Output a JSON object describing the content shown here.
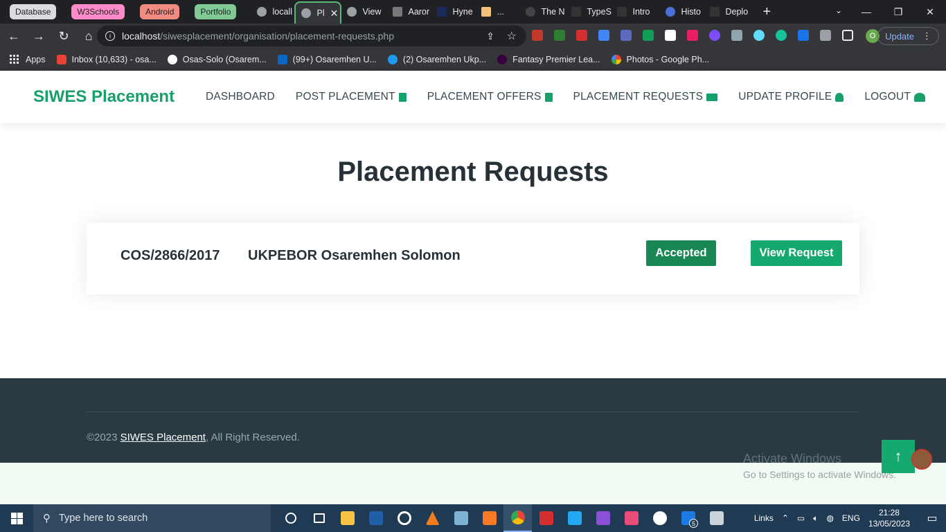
{
  "browser": {
    "tab_groups": [
      {
        "label": "Database",
        "color": "#dadce0"
      },
      {
        "label": "W3Schools",
        "color": "#ff8bcb"
      },
      {
        "label": "Android",
        "color": "#f28b82"
      },
      {
        "label": "Portfolio",
        "color": "#81c995"
      }
    ],
    "tabs": [
      {
        "label": "locall"
      },
      {
        "label": "Pl",
        "active": true
      },
      {
        "label": "View"
      },
      {
        "label": "Aaror"
      },
      {
        "label": "Hyne"
      },
      {
        "label": "..."
      },
      {
        "label": "The N"
      },
      {
        "label": "TypeS"
      },
      {
        "label": "Intro"
      },
      {
        "label": "Histo"
      },
      {
        "label": "Deplo"
      }
    ],
    "url_host": "localhost",
    "url_path": "/siwesplacement/organisation/placement-requests.php",
    "profile_initial": "O",
    "update_label": "Update",
    "bookmarks": [
      {
        "label": "Apps"
      },
      {
        "label": "Inbox (10,633) - osa...",
        "color": "#ea4335"
      },
      {
        "label": "Osas-Solo (Osarem...",
        "color": "#ffffff"
      },
      {
        "label": "(99+) Osaremhen U...",
        "color": "#0a66c2"
      },
      {
        "label": "(2) Osaremhen Ukp...",
        "color": "#1d9bf0"
      },
      {
        "label": "Fantasy Premier Lea...",
        "color": "#37003c"
      },
      {
        "label": "Photos - Google Ph...",
        "color": "#fbbc04"
      }
    ]
  },
  "site": {
    "brand": "SIWES Placement",
    "brand_color": "#16a06a",
    "nav": [
      {
        "label": "DASHBOARD",
        "icon": "none"
      },
      {
        "label": "POST PLACEMENT",
        "icon": "file-icon"
      },
      {
        "label": "PLACEMENT OFFERS",
        "icon": "file-lines-icon"
      },
      {
        "label": "PLACEMENT REQUESTS",
        "icon": "envelopes-icon"
      },
      {
        "label": "UPDATE PROFILE",
        "icon": "user-icon"
      },
      {
        "label": "LOGOUT",
        "icon": "user-slash-icon"
      }
    ]
  },
  "main": {
    "title": "Placement Requests",
    "requests": [
      {
        "matric_no": "COS/2866/2017",
        "name": "UKPEBOR Osaremhen Solomon",
        "status": "Accepted",
        "status_color": "#198754",
        "action_label": "View Request"
      }
    ]
  },
  "footer": {
    "copyright_prefix": "©2023 ",
    "copyright_link": "SIWES Placement",
    "copyright_suffix": ", All Right Reserved."
  },
  "overlay": {
    "activate_title": "Activate Windows",
    "activate_sub": "Go to Settings to activate Windows."
  },
  "taskbar": {
    "search_placeholder": "Type here to search",
    "tray_links": "Links",
    "tray_lang": "ENG",
    "time": "21:28",
    "date": "13/05/2023",
    "badge_count": "5"
  }
}
